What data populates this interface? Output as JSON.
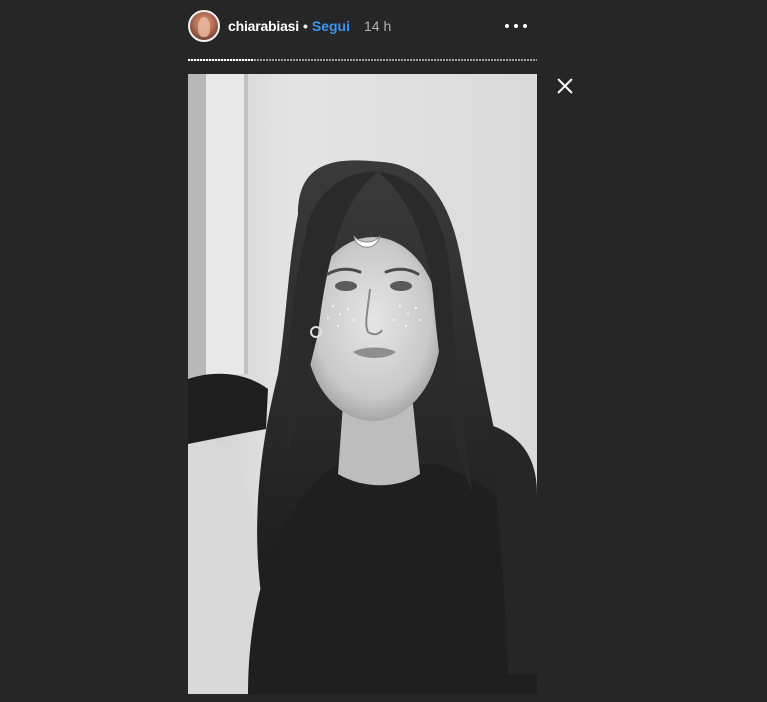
{
  "header": {
    "username": "chiarabiasi",
    "separator": "•",
    "follow_label": "Segui",
    "time_ago": "14 h"
  },
  "progress": {
    "fraction": 0.19
  },
  "icons": {
    "avatar": "profile-avatar",
    "more": "more-options-icon",
    "close": "close-icon"
  },
  "colors": {
    "background": "#262626",
    "follow": "#3897f0",
    "text": "#ffffff"
  }
}
